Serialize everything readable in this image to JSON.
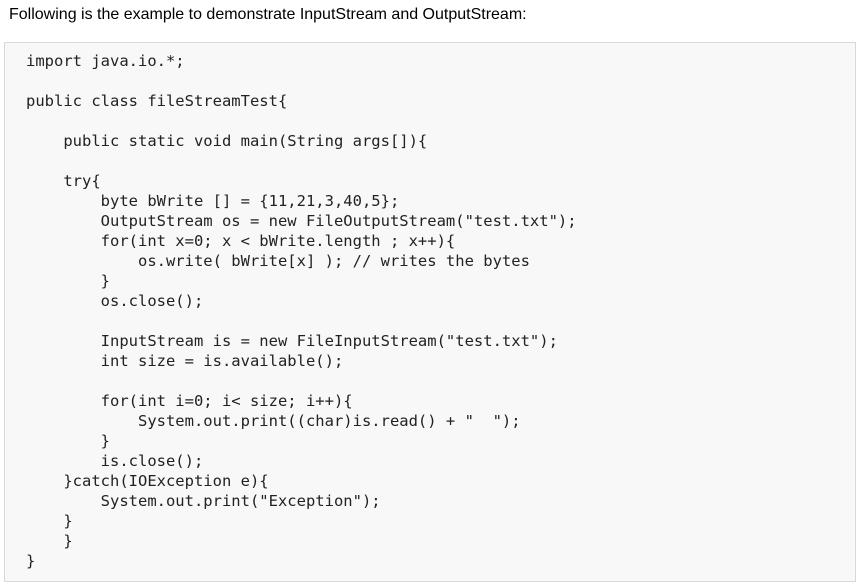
{
  "intro_text": "Following is the example to demonstrate InputStream and OutputStream:",
  "code_lines": [
    "import java.io.*;",
    "",
    "public class fileStreamTest{",
    "",
    "    public static void main(String args[]){",
    "",
    "    try{",
    "        byte bWrite [] = {11,21,3,40,5};",
    "        OutputStream os = new FileOutputStream(\"test.txt\");",
    "        for(int x=0; x < bWrite.length ; x++){",
    "            os.write( bWrite[x] ); // writes the bytes",
    "        }",
    "        os.close();",
    "",
    "        InputStream is = new FileInputStream(\"test.txt\");",
    "        int size = is.available();",
    "",
    "        for(int i=0; i< size; i++){",
    "            System.out.print((char)is.read() + \"  \");",
    "        }",
    "        is.close();",
    "    }catch(IOException e){",
    "        System.out.print(\"Exception\");",
    "    }",
    "    }",
    "}"
  ]
}
